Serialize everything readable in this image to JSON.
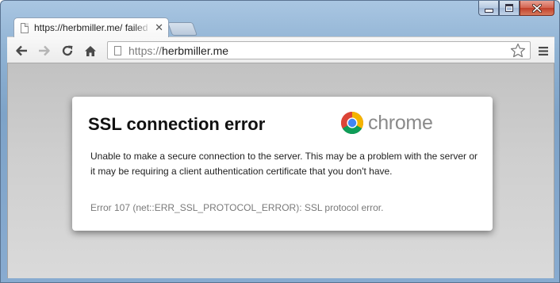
{
  "window": {
    "controls": [
      "minimize",
      "maximize",
      "close"
    ]
  },
  "tabs": [
    {
      "title": "https://herbmiller.me/ failed",
      "icon": "page-icon",
      "close_icon": "close-icon"
    }
  ],
  "toolbar": {
    "back_icon": "back-arrow-icon",
    "forward_icon": "forward-arrow-icon",
    "reload_icon": "reload-icon",
    "home_icon": "home-icon",
    "address": {
      "scheme": "https://",
      "host": "herbmiller.me"
    },
    "bookmark_icon": "star-icon",
    "menu_icon": "hamburger-menu-icon"
  },
  "error_page": {
    "heading": "SSL connection error",
    "brand": "chrome",
    "message": "Unable to make a secure connection to the server. This may be a problem with the server or it may be requiring a client authentication certificate that you don't have.",
    "error_code": "Error 107 (net::ERR_SSL_PROTOCOL_ERROR): SSL protocol error."
  },
  "colors": {
    "window_frame": "#8fb2d3",
    "close_button": "#c1402a",
    "content_background": "#cfcfcf",
    "heading_text": "#111111",
    "error_code_text": "#7a7a7a",
    "brand_text": "#8a8a8a"
  }
}
